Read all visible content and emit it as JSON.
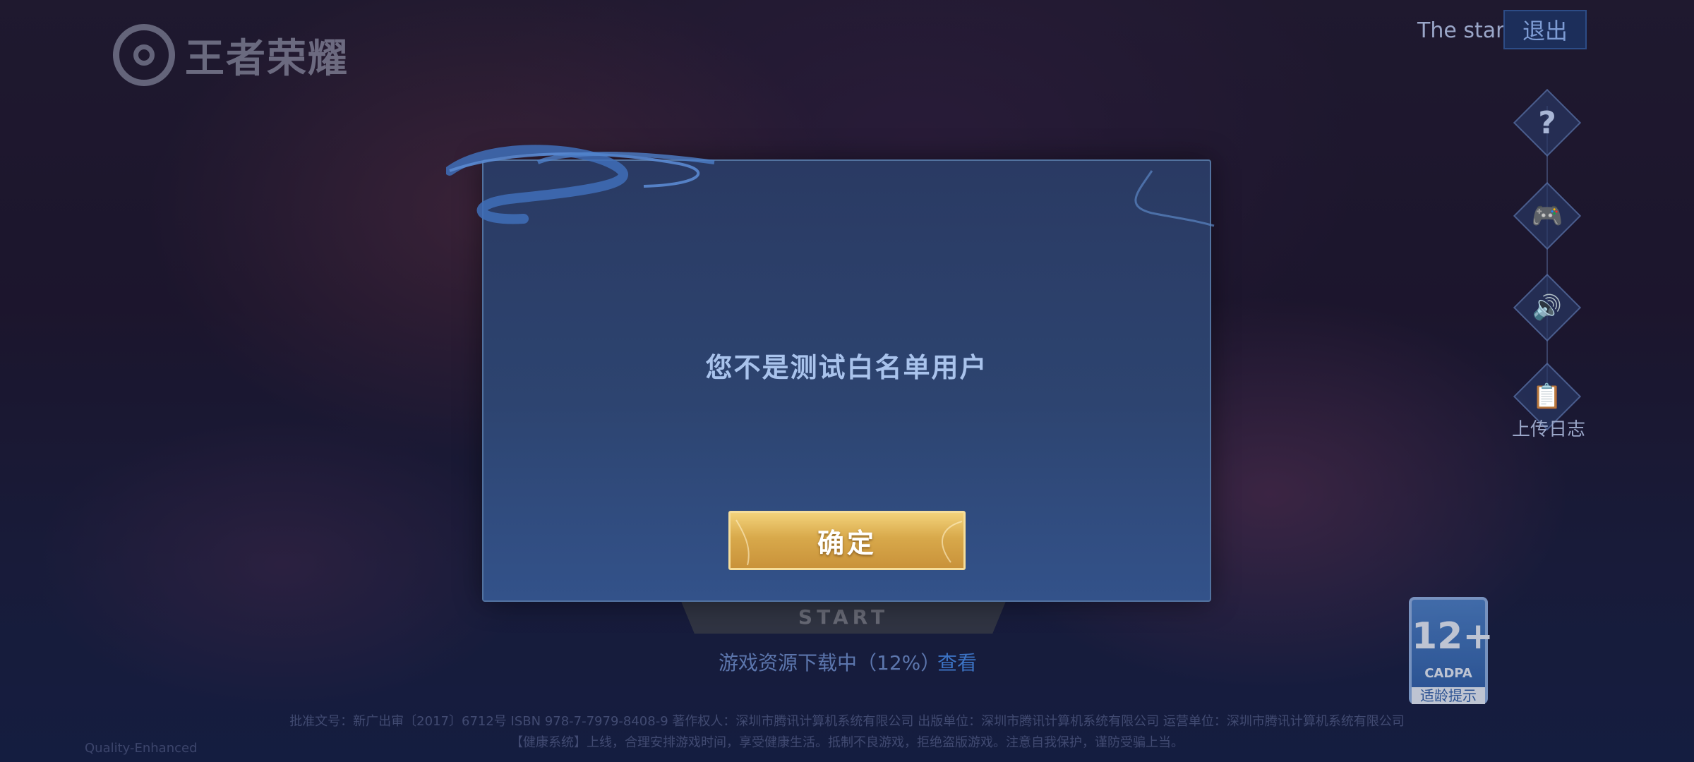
{
  "logo": {
    "text": "王者荣耀"
  },
  "header": {
    "user_name": "The star",
    "logout_label": "退出"
  },
  "side_menu": {
    "items": [
      {
        "icon": "question-icon",
        "glyph": "?"
      },
      {
        "icon": "gamepad-icon",
        "glyph": "🎮"
      },
      {
        "icon": "speaker-icon",
        "glyph": "🔊"
      },
      {
        "icon": "clipboard-icon",
        "glyph": "📋"
      }
    ],
    "upload_log_label": "上传日志"
  },
  "start": {
    "label": "START"
  },
  "download": {
    "text": "游戏资源下载中（12%）",
    "link": "查看",
    "progress": 0.12
  },
  "age_badge": {
    "rating": "12+",
    "org": "CADPA",
    "tip": "适龄提示"
  },
  "footer": {
    "line1": "批准文号：新广出审〔2017〕6712号  ISBN 978-7-7979-8408-9  著作权人：深圳市腾讯计算机系统有限公司  出版单位：深圳市腾讯计算机系统有限公司  运营单位：深圳市腾讯计算机系统有限公司",
    "line2": "【健康系统】上线，合理安排游戏时间，享受健康生活。抵制不良游戏，拒绝盗版游戏。注意自我保护，谨防受骗上当。",
    "left": "Quality-Enhanced"
  },
  "dialog": {
    "message": "您不是测试白名单用户",
    "confirm_label": "确定"
  }
}
